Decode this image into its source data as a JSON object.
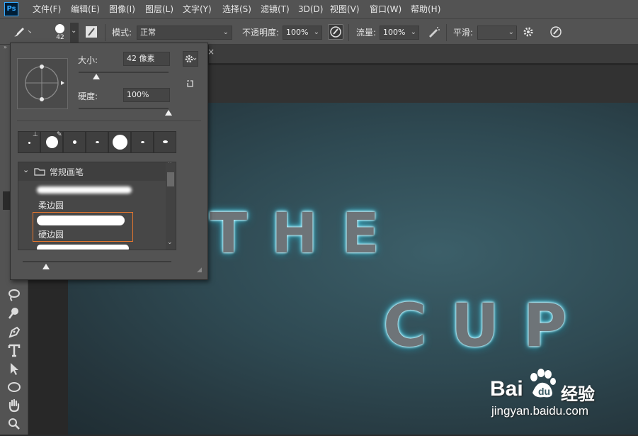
{
  "menu": {
    "app_logo": "Ps",
    "items": [
      "文件(F)",
      "编辑(E)",
      "图像(I)",
      "图层(L)",
      "文字(Y)",
      "选择(S)",
      "滤镜(T)",
      "3D(D)",
      "视图(V)",
      "窗口(W)",
      "帮助(H)"
    ]
  },
  "options": {
    "brush_size": "42",
    "mode_label": "模式:",
    "mode_value": "正常",
    "opacity_label": "不透明度:",
    "opacity_value": "100%",
    "flow_label": "流量:",
    "flow_value": "100%",
    "smoothing_label": "平滑:",
    "smoothing_value": ""
  },
  "brush_panel": {
    "size_label": "大小:",
    "size_value": "42 像素",
    "size_slider_fraction": 0.2,
    "hardness_label": "硬度:",
    "hardness_value": "100%",
    "hardness_slider_fraction": 1.0,
    "folder_name": "常规画笔",
    "brushes": [
      {
        "name": "柔边圆",
        "selected": false
      },
      {
        "name": "硬边圆",
        "selected": true
      }
    ],
    "selection_color": "#e8772e"
  },
  "document": {
    "tab_close": "×",
    "text_line1": "THE",
    "text_line2": "CUP"
  },
  "watermark": {
    "logo_text": "Bai",
    "logo_suffix": "经验",
    "url": "jingyan.baidu.com"
  },
  "colors": {
    "accent": "#31a8ff",
    "glow": "#5ed9ef"
  }
}
